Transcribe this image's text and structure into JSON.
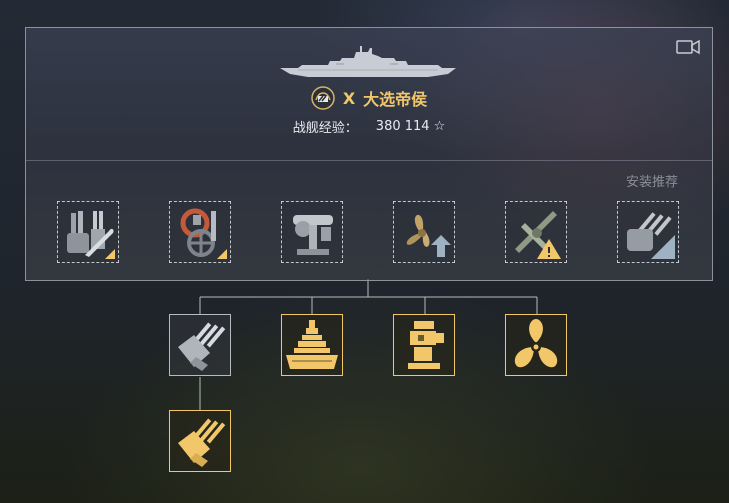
{
  "header": {
    "tier": "X",
    "ship_name": "大选帝侯",
    "xp_label": "战舰经验：",
    "xp_value": "380 114",
    "recommend_label": "安装推荐"
  },
  "icons": {
    "camera": "camera-icon",
    "star": "star-icon",
    "emblem": "german-nation-emblem-icon"
  },
  "colors": {
    "gold": "#f2c76a",
    "gray_frame": "#b7bbc1",
    "panel_border": "#8b929c"
  },
  "upgrade_slots": [
    {
      "name": "main-armaments-modification-slot",
      "icon": "main-battery-wrench-icon"
    },
    {
      "name": "damage-control-system-slot",
      "icon": "hose-valve-icon"
    },
    {
      "name": "artillery-rangefinder-slot",
      "icon": "rangefinder-icon"
    },
    {
      "name": "propulsion-modification-slot",
      "icon": "propeller-upgrade-icon"
    },
    {
      "name": "aircraft-modification-slot",
      "icon": "seaplane-warning-icon"
    },
    {
      "name": "gun-fire-control-slot",
      "icon": "turret-range-icon"
    }
  ],
  "module_tree": [
    {
      "name": "main-battery-module",
      "icon": "main-battery-icon",
      "state": "gray"
    },
    {
      "name": "hull-module",
      "icon": "hull-icon",
      "state": "gold"
    },
    {
      "name": "fire-control-module",
      "icon": "fire-control-icon",
      "state": "gold"
    },
    {
      "name": "engine-module",
      "icon": "propeller-icon",
      "state": "gold"
    },
    {
      "name": "main-battery-upgraded-module",
      "icon": "main-battery-icon",
      "state": "gold"
    }
  ]
}
